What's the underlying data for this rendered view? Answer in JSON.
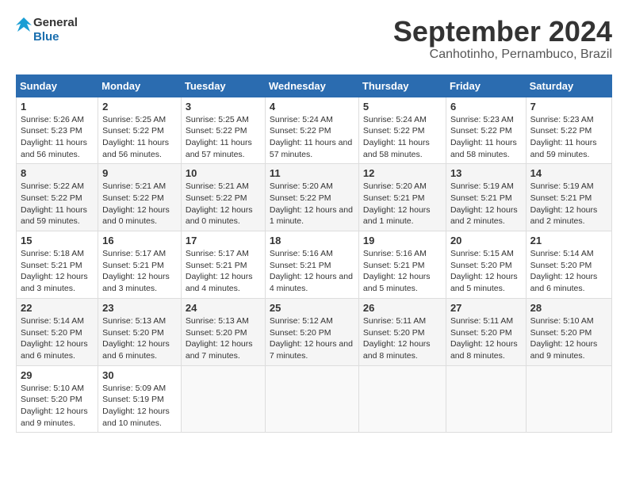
{
  "logo": {
    "line1": "General",
    "line2": "Blue"
  },
  "title": "September 2024",
  "subtitle": "Canhotinho, Pernambuco, Brazil",
  "weekdays": [
    "Sunday",
    "Monday",
    "Tuesday",
    "Wednesday",
    "Thursday",
    "Friday",
    "Saturday"
  ],
  "weeks": [
    [
      {
        "day": "1",
        "sunrise": "Sunrise: 5:26 AM",
        "sunset": "Sunset: 5:23 PM",
        "daylight": "Daylight: 11 hours and 56 minutes."
      },
      {
        "day": "2",
        "sunrise": "Sunrise: 5:25 AM",
        "sunset": "Sunset: 5:22 PM",
        "daylight": "Daylight: 11 hours and 56 minutes."
      },
      {
        "day": "3",
        "sunrise": "Sunrise: 5:25 AM",
        "sunset": "Sunset: 5:22 PM",
        "daylight": "Daylight: 11 hours and 57 minutes."
      },
      {
        "day": "4",
        "sunrise": "Sunrise: 5:24 AM",
        "sunset": "Sunset: 5:22 PM",
        "daylight": "Daylight: 11 hours and 57 minutes."
      },
      {
        "day": "5",
        "sunrise": "Sunrise: 5:24 AM",
        "sunset": "Sunset: 5:22 PM",
        "daylight": "Daylight: 11 hours and 58 minutes."
      },
      {
        "day": "6",
        "sunrise": "Sunrise: 5:23 AM",
        "sunset": "Sunset: 5:22 PM",
        "daylight": "Daylight: 11 hours and 58 minutes."
      },
      {
        "day": "7",
        "sunrise": "Sunrise: 5:23 AM",
        "sunset": "Sunset: 5:22 PM",
        "daylight": "Daylight: 11 hours and 59 minutes."
      }
    ],
    [
      {
        "day": "8",
        "sunrise": "Sunrise: 5:22 AM",
        "sunset": "Sunset: 5:22 PM",
        "daylight": "Daylight: 11 hours and 59 minutes."
      },
      {
        "day": "9",
        "sunrise": "Sunrise: 5:21 AM",
        "sunset": "Sunset: 5:22 PM",
        "daylight": "Daylight: 12 hours and 0 minutes."
      },
      {
        "day": "10",
        "sunrise": "Sunrise: 5:21 AM",
        "sunset": "Sunset: 5:22 PM",
        "daylight": "Daylight: 12 hours and 0 minutes."
      },
      {
        "day": "11",
        "sunrise": "Sunrise: 5:20 AM",
        "sunset": "Sunset: 5:22 PM",
        "daylight": "Daylight: 12 hours and 1 minute."
      },
      {
        "day": "12",
        "sunrise": "Sunrise: 5:20 AM",
        "sunset": "Sunset: 5:21 PM",
        "daylight": "Daylight: 12 hours and 1 minute."
      },
      {
        "day": "13",
        "sunrise": "Sunrise: 5:19 AM",
        "sunset": "Sunset: 5:21 PM",
        "daylight": "Daylight: 12 hours and 2 minutes."
      },
      {
        "day": "14",
        "sunrise": "Sunrise: 5:19 AM",
        "sunset": "Sunset: 5:21 PM",
        "daylight": "Daylight: 12 hours and 2 minutes."
      }
    ],
    [
      {
        "day": "15",
        "sunrise": "Sunrise: 5:18 AM",
        "sunset": "Sunset: 5:21 PM",
        "daylight": "Daylight: 12 hours and 3 minutes."
      },
      {
        "day": "16",
        "sunrise": "Sunrise: 5:17 AM",
        "sunset": "Sunset: 5:21 PM",
        "daylight": "Daylight: 12 hours and 3 minutes."
      },
      {
        "day": "17",
        "sunrise": "Sunrise: 5:17 AM",
        "sunset": "Sunset: 5:21 PM",
        "daylight": "Daylight: 12 hours and 4 minutes."
      },
      {
        "day": "18",
        "sunrise": "Sunrise: 5:16 AM",
        "sunset": "Sunset: 5:21 PM",
        "daylight": "Daylight: 12 hours and 4 minutes."
      },
      {
        "day": "19",
        "sunrise": "Sunrise: 5:16 AM",
        "sunset": "Sunset: 5:21 PM",
        "daylight": "Daylight: 12 hours and 5 minutes."
      },
      {
        "day": "20",
        "sunrise": "Sunrise: 5:15 AM",
        "sunset": "Sunset: 5:20 PM",
        "daylight": "Daylight: 12 hours and 5 minutes."
      },
      {
        "day": "21",
        "sunrise": "Sunrise: 5:14 AM",
        "sunset": "Sunset: 5:20 PM",
        "daylight": "Daylight: 12 hours and 6 minutes."
      }
    ],
    [
      {
        "day": "22",
        "sunrise": "Sunrise: 5:14 AM",
        "sunset": "Sunset: 5:20 PM",
        "daylight": "Daylight: 12 hours and 6 minutes."
      },
      {
        "day": "23",
        "sunrise": "Sunrise: 5:13 AM",
        "sunset": "Sunset: 5:20 PM",
        "daylight": "Daylight: 12 hours and 6 minutes."
      },
      {
        "day": "24",
        "sunrise": "Sunrise: 5:13 AM",
        "sunset": "Sunset: 5:20 PM",
        "daylight": "Daylight: 12 hours and 7 minutes."
      },
      {
        "day": "25",
        "sunrise": "Sunrise: 5:12 AM",
        "sunset": "Sunset: 5:20 PM",
        "daylight": "Daylight: 12 hours and 7 minutes."
      },
      {
        "day": "26",
        "sunrise": "Sunrise: 5:11 AM",
        "sunset": "Sunset: 5:20 PM",
        "daylight": "Daylight: 12 hours and 8 minutes."
      },
      {
        "day": "27",
        "sunrise": "Sunrise: 5:11 AM",
        "sunset": "Sunset: 5:20 PM",
        "daylight": "Daylight: 12 hours and 8 minutes."
      },
      {
        "day": "28",
        "sunrise": "Sunrise: 5:10 AM",
        "sunset": "Sunset: 5:20 PM",
        "daylight": "Daylight: 12 hours and 9 minutes."
      }
    ],
    [
      {
        "day": "29",
        "sunrise": "Sunrise: 5:10 AM",
        "sunset": "Sunset: 5:20 PM",
        "daylight": "Daylight: 12 hours and 9 minutes."
      },
      {
        "day": "30",
        "sunrise": "Sunrise: 5:09 AM",
        "sunset": "Sunset: 5:19 PM",
        "daylight": "Daylight: 12 hours and 10 minutes."
      },
      null,
      null,
      null,
      null,
      null
    ]
  ]
}
